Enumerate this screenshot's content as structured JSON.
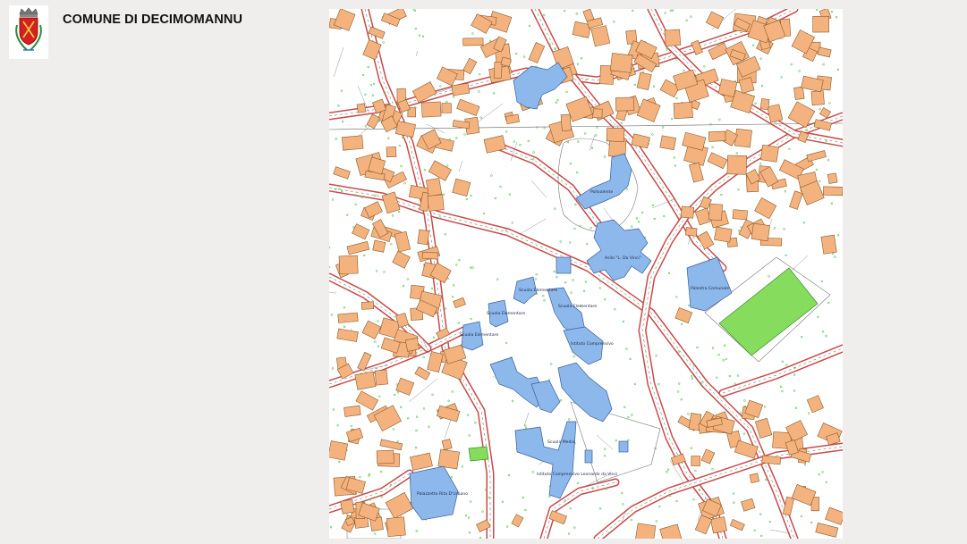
{
  "header": {
    "title": "COMUNE DI DECIMOMANNU",
    "coat_of_arms": "municipal-coat-of-arms"
  },
  "map": {
    "colors": {
      "building": "#f4b37e",
      "public_building": "#8db8ec",
      "sports_field": "#86dc5c",
      "road_edge": "#c94a4a",
      "vegetation": "#58c458",
      "street_line": "#555555"
    },
    "labels": {
      "scuola_1": "Scuola Elementare",
      "scuola_2": "Scuola Elementare",
      "scuola_3": "Scuola Elementare",
      "scuola_4": "Scuola Elementare",
      "scuola_media": "Scuola Media",
      "istituto": "Istituto Comprensivo",
      "istituto_full": "Istituto Comprensivo Leonardo da Vinci",
      "polivalente": "Polivalente",
      "asilo": "Asilo \"L. Da Vinci\"",
      "palestra": "Palestra Comunale",
      "palazzetto": "Palazzetto Rita D'Urbano"
    }
  }
}
